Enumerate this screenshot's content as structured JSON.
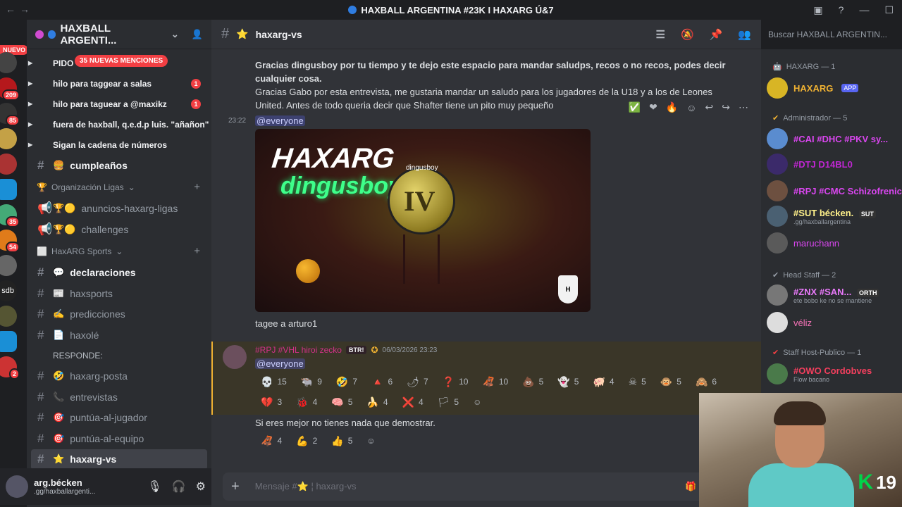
{
  "window": {
    "title": "HAXBALL ARGENTINA #23K I HAXARG Ú&7"
  },
  "colors": {
    "bg_main": "#313338",
    "bg_sidebar": "#2b2d31",
    "mention_badge": "#f23f43",
    "author_color": "#d5318a",
    "accent": "#5865f2"
  },
  "servers": {
    "new_label": "NUEVO",
    "badges": [
      "209",
      "85",
      "35",
      "54",
      "2"
    ],
    "label_sdb": "sdb"
  },
  "sidebar": {
    "server_name": "HAXBALL ARGENTI...",
    "mentions_label": "35 NUEVAS MENCIONES",
    "threads": [
      {
        "label": "PIDO",
        "count": ""
      },
      {
        "label": "hilo para taggear a salas",
        "count": "1"
      },
      {
        "label": "hilo para taguear a @maxikz",
        "count": "1"
      },
      {
        "label": "fuera de haxball, q.e.d.p luis. \"añañon\"",
        "count": ""
      },
      {
        "label": "Sigan la cadena de números",
        "count": ""
      }
    ],
    "channel_cumple": "cumpleaños",
    "cat_ligas": "Organización Ligas",
    "ch_anuncios": "anuncios-haxarg-ligas",
    "ch_challenges": "challenges",
    "cat_sports": "HaxARG Sports",
    "ch_declaraciones": "declaraciones",
    "ch_haxsports": "haxsports",
    "ch_predicciones": "predicciones",
    "ch_haxole": "haxolé",
    "responde": "RESPONDE:",
    "ch_posta": "haxarg-posta",
    "ch_entrevistas": "entrevistas",
    "ch_jugador": "puntúa-al-jugador",
    "ch_equipo": "puntúa-al-equipo",
    "ch_vs": "haxarg-vs"
  },
  "user": {
    "name": "arg.bécken",
    "status": ".gg/haxballargenti..."
  },
  "main": {
    "channel": "haxarg-vs",
    "msg1_line1": "Gracias dingusboy por tu tiempo y te dejo este espacio para mandar saludps, recos o no recos, podes decir cualquier cosa.",
    "msg1_line2": "Gracias Gabo por esta entrevista, me gustaria mandar un saludo para los jugadores de la U18 y a los de Leones United. Antes de todo queria decir que Shafter tiene un pito muy pequeño",
    "time1": "23:22",
    "everyone": "@everyone",
    "img_title1": "HAXARG",
    "img_title2": "dingusboy",
    "img_ball_label": "dingusboy",
    "img_ball_num": "IV",
    "caption": "tagee a arturo1",
    "author": "#RPJ #VHL hiroi zecko",
    "author_tag": "BTR!",
    "date2": "06/03/2026 23:23",
    "reacts_row1": [
      [
        "💀",
        "15"
      ],
      [
        "🐃",
        "9"
      ],
      [
        "🤣",
        "7"
      ],
      [
        "🔺",
        "6"
      ],
      [
        "🌶",
        "7"
      ],
      [
        "❓",
        "10"
      ],
      [
        "🦧",
        "10"
      ],
      [
        "💩",
        "5"
      ],
      [
        "👻",
        "5"
      ],
      [
        "🐖",
        "4"
      ],
      [
        "☠",
        "5"
      ],
      [
        "🐵",
        "5"
      ],
      [
        "🙈",
        "6"
      ]
    ],
    "reacts_row2": [
      [
        "💔",
        "3"
      ],
      [
        "🐞",
        "4"
      ],
      [
        "🧠",
        "5"
      ],
      [
        "🍌",
        "4"
      ],
      [
        "❌",
        "4"
      ],
      [
        "🏳",
        "5"
      ]
    ],
    "msg3": "Si eres mejor no tienes nada que demostrar.",
    "reacts_row3": [
      [
        "🦧",
        "4"
      ],
      [
        "💪",
        "2"
      ],
      [
        "👍",
        "5"
      ]
    ],
    "input_placeholder": "Mensaje #⭐ ¦ haxarg-vs"
  },
  "members": {
    "search": "Buscar  HAXBALL ARGENTIN...",
    "grp_bot": "HAXARG — 1",
    "bot_name": "HAXARG",
    "app": "APP",
    "grp_admin": "Administrador — 5",
    "admins": [
      {
        "name": "#CAI #DHC #PKV sy...",
        "color": "#d946ef",
        "sub": ""
      },
      {
        "name": "#DTJ D14BL0",
        "color": "#c026d3",
        "sub": ""
      },
      {
        "name": "#RPJ #CMC Schizofrenic",
        "color": "#d946ef",
        "sub": ""
      },
      {
        "name": "#SUT bécken.",
        "color": "#fef08a",
        "sub": ".gg/haxballargentina"
      },
      {
        "name": "maruchann",
        "color": "#d946ef",
        "sub": ""
      }
    ],
    "sut_tag": "SUT",
    "grp_head": "Head Staff — 2",
    "heads": [
      {
        "name": "#ZNX #SAN...",
        "color": "#e879f9",
        "sub": "ete bobo ke no se mantiene"
      },
      {
        "name": "véliz",
        "color": "#f472b6",
        "sub": ""
      }
    ],
    "orth_tag": "ORTH",
    "grp_host": "Staff Host-Publico — 1",
    "host": {
      "name": "#OWO Cordobves",
      "color": "#f43f5e",
      "sub": "Flow bacano"
    }
  },
  "cam": {
    "overlay": "19"
  }
}
